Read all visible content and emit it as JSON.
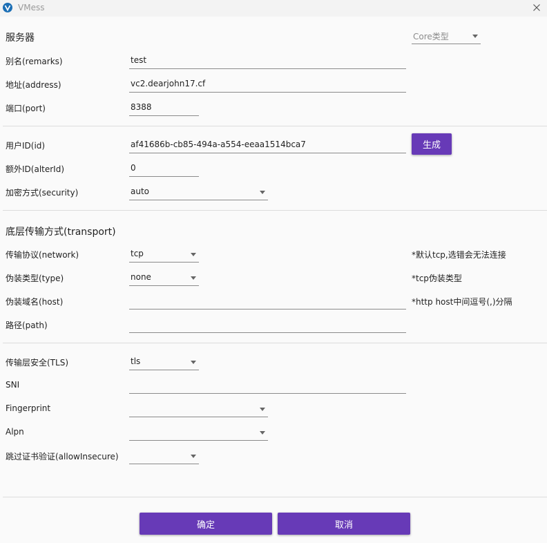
{
  "window": {
    "title": "VMess"
  },
  "colors": {
    "accent": "#673ab7",
    "app_icon": "#1c6fb5"
  },
  "server": {
    "section_title": "服务器",
    "core_type_placeholder": "Core类型",
    "remarks_label": "别名(remarks)",
    "remarks_value": "test",
    "address_label": "地址(address)",
    "address_value": "vc2.dearjohn17.cf",
    "port_label": "端口(port)",
    "port_value": "8388"
  },
  "user": {
    "id_label": "用户ID(id)",
    "id_value": "af41686b-cb85-494a-a554-eeaa1514bca7",
    "generate_label": "生成",
    "alter_id_label": "额外ID(alterId)",
    "alter_id_value": "0",
    "security_label": "加密方式(security)",
    "security_value": "auto"
  },
  "transport": {
    "section_title": "底层传输方式(transport)",
    "network_label": "传输协议(network)",
    "network_value": "tcp",
    "network_hint": "*默认tcp,选错会无法连接",
    "type_label": "伪装类型(type)",
    "type_value": "none",
    "type_hint": "*tcp伪装类型",
    "host_label": "伪装域名(host)",
    "host_value": "",
    "host_hint": "*http host中间逗号(,)分隔",
    "path_label": "路径(path)",
    "path_value": ""
  },
  "tls": {
    "security_label": "传输层安全(TLS)",
    "security_value": "tls",
    "sni_label": "SNI",
    "sni_value": "",
    "fingerprint_label": "Fingerprint",
    "fingerprint_value": "",
    "alpn_label": "Alpn",
    "alpn_value": "",
    "allow_insecure_label": "跳过证书验证(allowInsecure)",
    "allow_insecure_value": ""
  },
  "footer": {
    "ok_label": "确定",
    "cancel_label": "取消"
  }
}
